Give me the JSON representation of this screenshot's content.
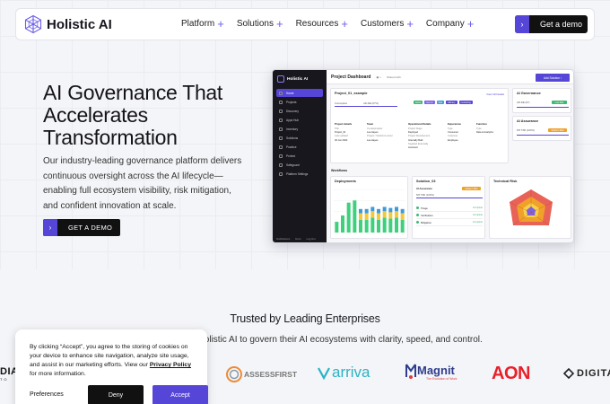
{
  "nav": {
    "brand": "Holistic AI",
    "links": [
      {
        "label": "Platform"
      },
      {
        "label": "Solutions"
      },
      {
        "label": "Resources"
      },
      {
        "label": "Customers"
      },
      {
        "label": "Company"
      }
    ],
    "cta": "Get a demo"
  },
  "hero": {
    "title": "AI Governance That Accelerates Transformation",
    "description": "Our industry-leading governance platform delivers continuous oversight across the AI lifecycle—enabling full ecosystem visibility, risk mitigation, and confident innovation at scale.",
    "cta": "GET A DEMO"
  },
  "dashboard": {
    "brand": "Holistic AI",
    "sidebar": [
      "Home",
      "Projects",
      "Discovery",
      "Apps Hub",
      "Inventory",
      "Solutions",
      "Practice",
      "Protect",
      "Safeguard",
      "Platform Settings"
    ],
    "footer": [
      "Notifications",
      "Docs",
      "Log Out"
    ],
    "header_title": "Project Dashboard",
    "header_extra": "Shared with",
    "add_button": "Add Solution",
    "project_card": {
      "title": "Project_01_example",
      "link": "View full Details",
      "stage_a": "Conception",
      "stage_b": "AD-DE (67%)",
      "tags": [
        "active",
        "Gen AI",
        "Risk",
        "Efficacy",
        "monitoring"
      ],
      "details_title": "Project details",
      "details": [
        "Title",
        "Project_01",
        "Last updated",
        "30 Jun 2022"
      ],
      "team_title": "Team",
      "team": [
        "Co-Helpmaster",
        "Lee Hayes",
        "Project / Solutions owner",
        "Lee Hayes"
      ],
      "ops_title": "Operational Details",
      "ops": [
        "Project Stage",
        "Deployed",
        "Project Development",
        "Internally Built",
        "Supplied Externally",
        "Licensed"
      ],
      "exp_title": "Experience",
      "exp": [
        "Type",
        "Consumer",
        "Customer",
        "Employee"
      ],
      "func_title": "Function",
      "func": [
        "Type",
        "Data & Analytics"
      ]
    },
    "gov_card": {
      "title": "AI Governance",
      "value": "AD-DE (67)",
      "badge": "Low Risk"
    },
    "assur_card": {
      "title": "AI Assurance",
      "value": "5/8 7/80 (100%)",
      "badge": "Medium Risk"
    },
    "workflows": "Workflows",
    "deployments_title": "Deployments",
    "solution_card": {
      "title": "Solution_03",
      "sub": "AI Assurance",
      "badge": "Medium Risk",
      "value": "5/8 7/80 (100%)",
      "rows": [
        {
          "name": "Triage",
          "status": "Complete"
        },
        {
          "name": "Verification",
          "status": "Complete"
        },
        {
          "name": "Mitigation",
          "status": "Complete"
        }
      ]
    },
    "risk_title": "Technical Risk"
  },
  "chart_data": {
    "type": "bar",
    "title": "Deployments",
    "categories": [
      "1",
      "2",
      "3",
      "4",
      "5",
      "6",
      "7",
      "8",
      "9",
      "10",
      "11",
      "12"
    ],
    "series": [
      {
        "color": "#3fd07d",
        "values": [
          10,
          16,
          28,
          30,
          12,
          12,
          14,
          12,
          14,
          13,
          14,
          12
        ]
      },
      {
        "color": "#f0c93e",
        "values": [
          0,
          0,
          0,
          0,
          6,
          6,
          6,
          6,
          6,
          6,
          6,
          6
        ]
      },
      {
        "color": "#3f9bd8",
        "values": [
          0,
          0,
          0,
          0,
          4,
          4,
          4,
          4,
          4,
          4,
          4,
          4
        ]
      }
    ]
  },
  "trusted": {
    "title": "Trusted by Leading Enterprises",
    "subtitle": "n Holistic AI to govern their AI ecosystems with clarity, speed, and control."
  },
  "brands": [
    {
      "name": "DIA",
      "sub": "TO"
    },
    {
      "name": "ASSESSFIRST"
    },
    {
      "name": "arriva"
    },
    {
      "name": "Magnit",
      "sub": "The Evolution of Work"
    },
    {
      "name": "AON"
    },
    {
      "name": "DIGITA"
    }
  ],
  "cookie": {
    "text_before": "By clicking “Accept”, you agree to the storing of cookies on your device to enhance site navigation, analyze site usage, and assist in our marketing efforts. View our ",
    "policy_link": "Privacy Policy",
    "text_after": " for more information.",
    "preferences": "Preferences",
    "deny": "Deny",
    "accept": "Accept"
  },
  "colors": {
    "accent": "#5546d8",
    "dark": "#111111",
    "plus": "#6a5ee6"
  }
}
